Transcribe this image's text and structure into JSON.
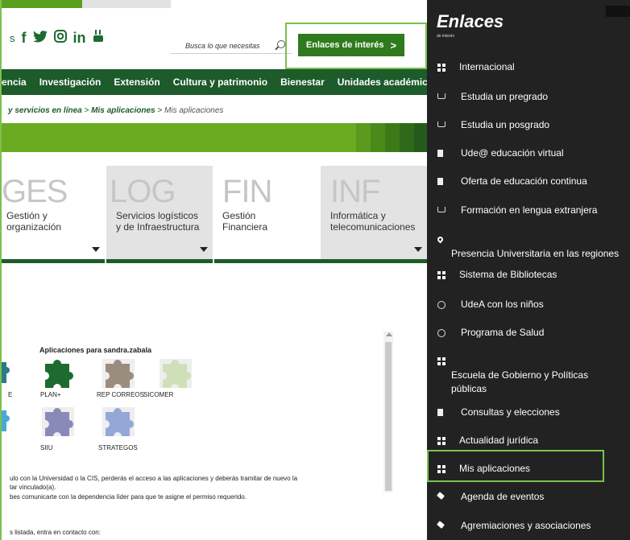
{
  "header": {
    "social_fragment": "s",
    "social_icons": [
      "facebook-icon",
      "twitter-icon",
      "instagram-icon",
      "linkedin-icon",
      "youtube-icon"
    ],
    "search_placeholder": "Busca lo que necesitas",
    "enlaces_button": "Enlaces de interés",
    "enlaces_arrow": ">"
  },
  "nav": {
    "items": [
      "encia",
      "Investigación",
      "Extensión",
      "Cultura y patrimonio",
      "Bienestar",
      "Unidades académicas"
    ]
  },
  "breadcrumb": {
    "part1": "y servicios en línea",
    "sep1": " > ",
    "part2": "Mis aplicaciones",
    "sep2": " > ",
    "part3": "Mis aplicaciones"
  },
  "tiles": [
    {
      "code": "GES",
      "label": "Gestión y organización"
    },
    {
      "code": "LOG",
      "label": "Servicios logísticos y de Infraestructura"
    },
    {
      "code": "FIN",
      "label": "Gestión Financiera"
    },
    {
      "code": "INF",
      "label": "Informática y telecomunicaciones"
    }
  ],
  "apps": {
    "title": "Aplicaciones para sandra.zabala",
    "items": [
      {
        "label": "E",
        "color": "#2a7a8a"
      },
      {
        "label": "PLAN+",
        "color": "#1d6b2f"
      },
      {
        "label": "REP CORREOS",
        "color": "#9b8d7e"
      },
      {
        "label": "SICOMER",
        "color": "#cfe0b8"
      },
      {
        "label": "",
        "color": "#4aa7d8"
      },
      {
        "label": "SIIU",
        "color": "#8a8ab8"
      },
      {
        "label": "STRATEGOS",
        "color": "#94a8d8"
      }
    ]
  },
  "notes": {
    "line1": "ulo con la Universidad o la CIS, perderás el acceso a las aplicaciones y deberás tramitar de nuevo la",
    "line2": "tar vinculado(a).",
    "line3": "bes comunicarte con la dependencia líder para que te asigne el permiso requerido.",
    "line4": "s listada, entra en contacto con:"
  },
  "panel": {
    "title": "Enlaces",
    "subtitle": "de interés",
    "links": [
      {
        "label": "Internacional",
        "icon": "grid-icon"
      },
      {
        "label": "Estudia un pregrado",
        "icon": "book-icon"
      },
      {
        "label": "Estudia un posgrado",
        "icon": "book-icon"
      },
      {
        "label": "Ude@ educación virtual",
        "icon": "document-icon"
      },
      {
        "label": "Oferta de educación continua",
        "icon": "document-icon"
      },
      {
        "label": "Formación en lengua extranjera",
        "icon": "book-icon"
      },
      {
        "label": "Presencia Universitaria en las regiones",
        "icon": "pin-icon"
      },
      {
        "label": "Sistema de Bibliotecas",
        "icon": "grid-icon"
      },
      {
        "label": "UdeA con los niños",
        "icon": "circle-icon"
      },
      {
        "label": "Programa de Salud",
        "icon": "circle-icon"
      },
      {
        "label": "Escuela de Gobierno y Políticas públicas",
        "icon": "grid-icon"
      },
      {
        "label": "Consultas y elecciones",
        "icon": "document-icon"
      },
      {
        "label": "Actualidad jurídica",
        "icon": "grid-icon"
      },
      {
        "label": "Mis aplicaciones",
        "icon": "grid-icon"
      },
      {
        "label": "Agenda de eventos",
        "icon": "tag-icon"
      },
      {
        "label": "Agremiaciones y asociaciones",
        "icon": "tag-icon"
      }
    ]
  }
}
